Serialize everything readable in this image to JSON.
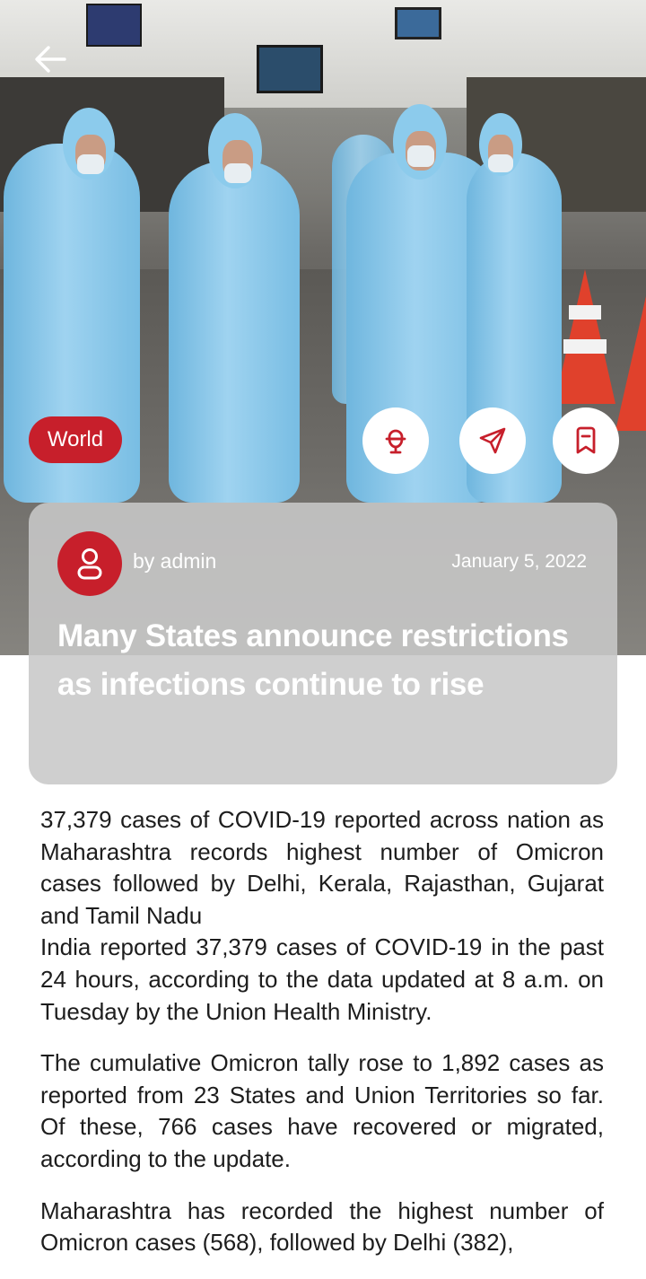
{
  "navigation": {
    "back_icon": "arrow-left-icon"
  },
  "article": {
    "category": "World",
    "author": "by admin",
    "date": "January 5, 2022",
    "title": "Many States announce restrictions as infections continue to rise",
    "actions": [
      {
        "name": "listen",
        "icon": "microphone-icon"
      },
      {
        "name": "share",
        "icon": "send-icon"
      },
      {
        "name": "bookmark",
        "icon": "bookmark-icon"
      }
    ],
    "body": {
      "summary": "37,379 cases of COVID-19 reported across nation as Maharashtra records highest number of Omicron cases followed by Delhi, Kerala, Rajasthan, Gujarat and Tamil Nadu",
      "paragraph_1": "India reported 37,379 cases of COVID-19 in the past 24 hours, according to the data updated at 8 a.m. on Tuesday by the Union Health Ministry.",
      "paragraph_2": "The cumulative Omicron tally rose to 1,892 cases as reported from 23 States and Union Territories so far. Of these, 766 cases have recovered or migrated, according to the update.",
      "paragraph_3": "Maharashtra has recorded the highest number of Omicron cases (568), followed by Delhi (382),"
    }
  },
  "colors": {
    "accent": "#c71f2b",
    "card_overlay": "#c8c8c8",
    "text": "#1d1d1d"
  }
}
